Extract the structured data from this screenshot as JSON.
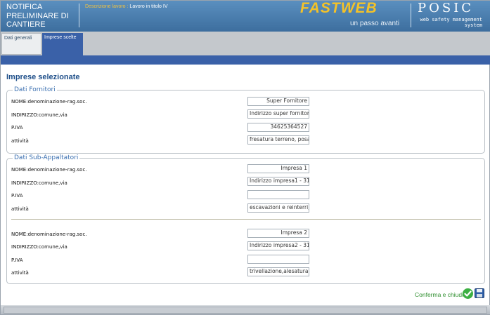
{
  "header": {
    "app_title": "NOTIFICA PRELIMINARE DI CANTIERE",
    "desc_label": "Descrizione lavoro :",
    "desc_value": "Lavoro in titolo IV",
    "brand": "FASTWEB",
    "brand_tagline": "un passo avanti",
    "product": "POSIC",
    "product_tagline": "web safety management system"
  },
  "tabs": [
    {
      "label": "Dati generali",
      "active": false
    },
    {
      "label": "Imprese scelte",
      "active": true
    }
  ],
  "page_title": "Imprese selezionate",
  "field_labels": {
    "name": "NOME:denominazione-rag.soc.",
    "address": "INDIRIZZO:comune,via",
    "vat": "P.IVA",
    "activity": "attività"
  },
  "suppliers": {
    "legend": "Dati Fornitori",
    "items": [
      {
        "name": "Super Fornitore",
        "address": "Indirizzo super fornitor",
        "vat": "34625364527",
        "activity": "fresatura terreno, posa"
      }
    ]
  },
  "subcontractors": {
    "legend": "Dati Sub-Appaltatori",
    "items": [
      {
        "name": "Impresa 1",
        "address": "Indirizzo impresa1 - 31",
        "vat": "",
        "activity": "escavazioni e reinterri,"
      },
      {
        "name": "Impresa 2",
        "address": "Indirizzo impresa2 - 31",
        "vat": "",
        "activity": "trivellazione,alesatura"
      }
    ]
  },
  "footer": {
    "confirm_label": "Conferma e chiudi",
    "icons": [
      "check-icon",
      "save-disk-icon"
    ]
  },
  "colors": {
    "accent_blue": "#3a61a8",
    "title_blue": "#20508a",
    "brand_yellow": "#f4c228",
    "confirm_green": "#2f8f2f"
  }
}
